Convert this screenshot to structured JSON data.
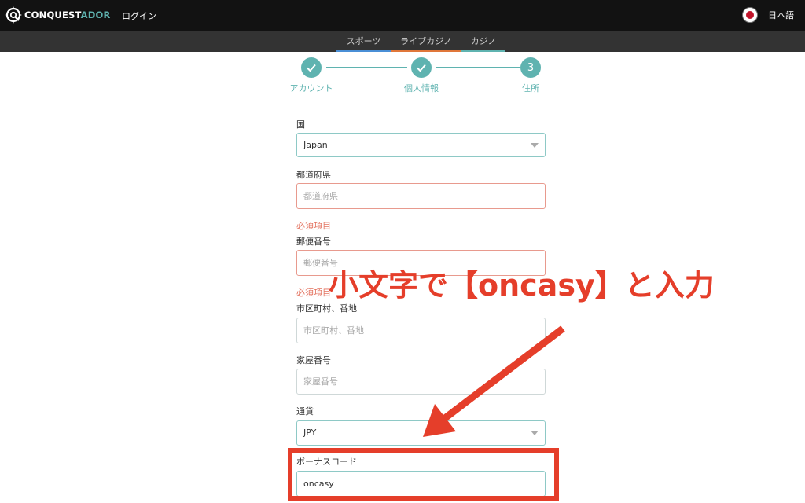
{
  "header": {
    "logo_text_main": "CONQUEST",
    "logo_text_accent": "ADOR",
    "login_label": "ログイン",
    "language_label": "日本語",
    "flag_icon": "japan-flag-icon"
  },
  "nav": {
    "tabs": [
      {
        "label": "スポーツ",
        "color": "#4a8fd6"
      },
      {
        "label": "ライブカジノ",
        "color": "#e0773a"
      },
      {
        "label": "カジノ",
        "color": "#5fb3b0"
      }
    ]
  },
  "stepper": {
    "steps": [
      {
        "label": "アカウント",
        "state": "complete",
        "icon": "check-icon"
      },
      {
        "label": "個人情報",
        "state": "complete",
        "icon": "check-icon"
      },
      {
        "label": "住所",
        "state": "current",
        "number": "3"
      }
    ],
    "accent_color": "#5fb3b0"
  },
  "form": {
    "country": {
      "label": "国",
      "value": "Japan"
    },
    "prefecture": {
      "label": "都道府県",
      "placeholder": "都道府県",
      "error": "必須項目"
    },
    "postal": {
      "label": "郵便番号",
      "placeholder": "郵便番号",
      "error": "必須項目"
    },
    "city": {
      "label": "市区町村、番地",
      "placeholder": "市区町村、番地"
    },
    "house": {
      "label": "家屋番号",
      "placeholder": "家屋番号"
    },
    "currency": {
      "label": "通貨",
      "value": "JPY"
    },
    "bonus": {
      "label": "ボーナスコード",
      "value": "oncasy"
    }
  },
  "annotation": {
    "text": "小文字で【oncasy】と入力",
    "color": "#e53e2a"
  }
}
